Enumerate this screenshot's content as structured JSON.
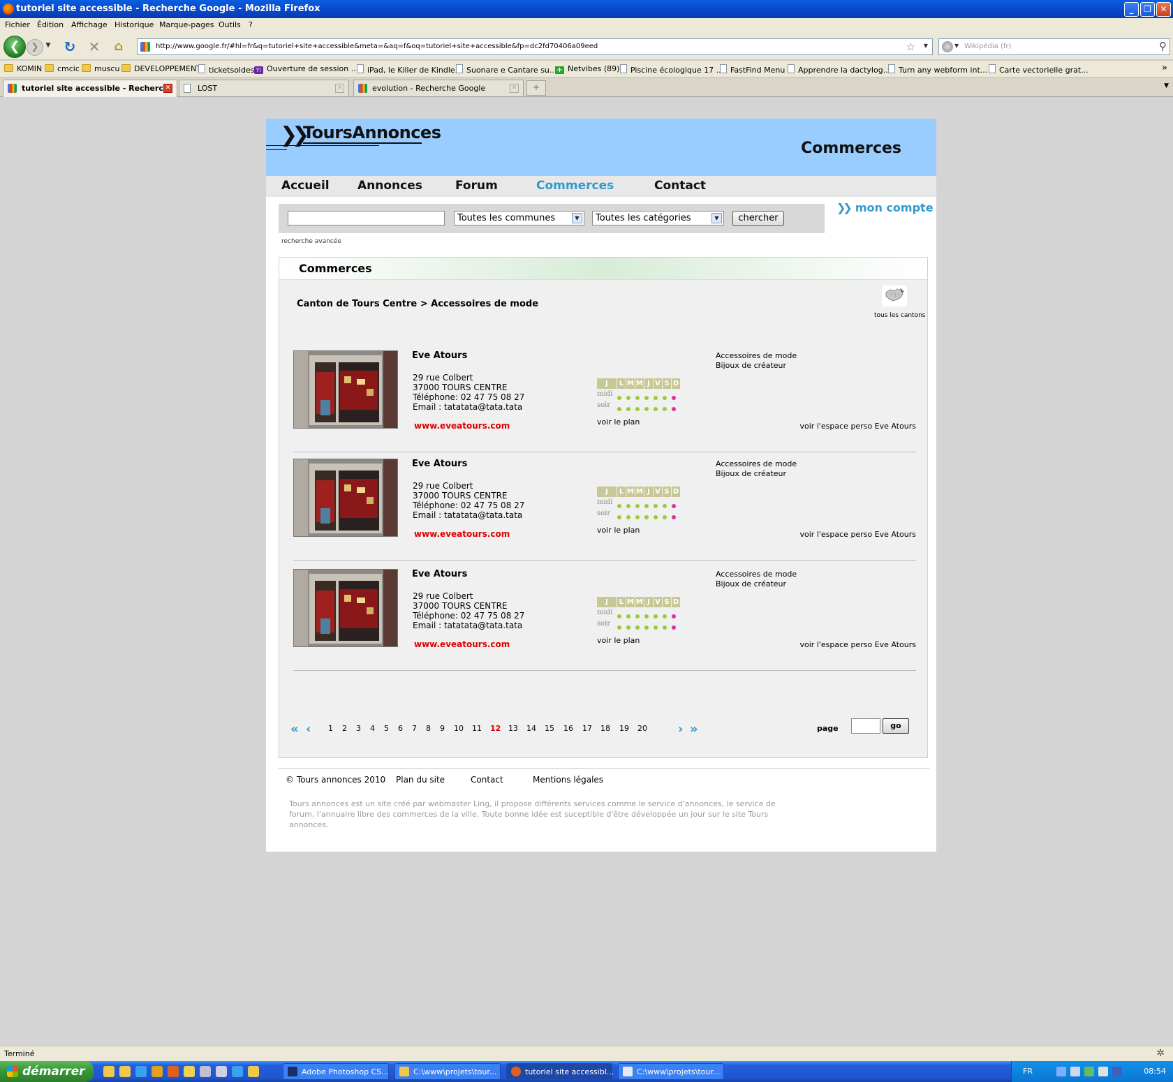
{
  "window": {
    "title": "tutoriel site accessible - Recherche Google - Mozilla Firefox"
  },
  "menu": [
    "Fichier",
    "Édition",
    "Affichage",
    "Historique",
    "Marque-pages",
    "Outils",
    "?"
  ],
  "url": "http://www.google.fr/#hl=fr&q=tutoriel+site+accessible&meta=&aq=f&oq=tutoriel+site+accessible&fp=dc2fd70406a09eed",
  "search_engine_placeholder": "Wikipédia (fr)",
  "bookmarks": [
    {
      "label": "KOMIN",
      "icon": "folder-icon"
    },
    {
      "label": "cmcic",
      "icon": "folder-icon"
    },
    {
      "label": "muscu",
      "icon": "folder-icon"
    },
    {
      "label": "DEVELOPPEMENT",
      "icon": "folder-icon"
    },
    {
      "label": "ticketsoldes",
      "icon": "page-icon"
    },
    {
      "label": "Ouverture de session ...",
      "icon": "yahoo-icon"
    },
    {
      "label": "iPad, le Killer de Kindle...",
      "icon": "page-icon"
    },
    {
      "label": "Suonare e Cantare su...",
      "icon": "page-icon"
    },
    {
      "label": "Netvibes (89)",
      "icon": "netvibes-icon"
    },
    {
      "label": "Piscine écologique 17 ...",
      "icon": "page-icon"
    },
    {
      "label": "FastFind Menu",
      "icon": "page-icon"
    },
    {
      "label": "Apprendre la dactylog...",
      "icon": "page-icon"
    },
    {
      "label": "Turn any webform int...",
      "icon": "page-icon"
    },
    {
      "label": "Carte vectorielle grat...",
      "icon": "page-icon"
    }
  ],
  "tabs": [
    {
      "label": "tutoriel site accessible - Recherc...",
      "active": true
    },
    {
      "label": "LOST",
      "active": false
    },
    {
      "label": "evolution - Recherche Google",
      "active": false
    }
  ],
  "site": {
    "logo": "ToursAnnonces",
    "header_title": "Commerces",
    "nav": [
      "Accueil",
      "Annonces",
      "Forum",
      "Commerces",
      "Contact"
    ],
    "nav_current": "Commerces",
    "search": {
      "query": "",
      "commune": "Toutes les communes",
      "categorie": "Toutes les catégories",
      "button": "chercher",
      "advanced": "recherche avancée"
    },
    "account": "mon compte",
    "section_title": "Commerces",
    "breadcrumb": "Canton de Tours Centre > Accessoires de mode",
    "all_cantons": "tous les cantons",
    "listings": [
      {
        "name": "Eve Atours",
        "street": "29 rue Colbert",
        "city": "37000 TOURS CENTRE",
        "phone": "Téléphone: 02 47 75 08 27",
        "email": "Email : tatatata@tata.tata",
        "website": "www.eveatours.com",
        "categories": [
          "Accessoires de mode",
          "Bijoux de créateur"
        ],
        "map_link": "voir le plan",
        "perso_link": "voir l'espace perso Eve Atours"
      },
      {
        "name": "Eve Atours",
        "street": "29 rue Colbert",
        "city": "37000 TOURS CENTRE",
        "phone": "Téléphone: 02 47 75 08 27",
        "email": "Email : tatatata@tata.tata",
        "website": "www.eveatours.com",
        "categories": [
          "Accessoires de mode",
          "Bijoux de créateur"
        ],
        "map_link": "voir le plan",
        "perso_link": "voir l'espace perso Eve Atours"
      },
      {
        "name": "Eve Atours",
        "street": "29 rue Colbert",
        "city": "37000 TOURS CENTRE",
        "phone": "Téléphone: 02 47 75 08 27",
        "email": "Email : tatatata@tata.tata",
        "website": "www.eveatours.com",
        "categories": [
          "Accessoires de mode",
          "Bijoux de créateur"
        ],
        "map_link": "voir le plan",
        "perso_link": "voir l'espace perso Eve Atours"
      }
    ],
    "hours": {
      "day_header": [
        "J",
        "L",
        "M",
        "M",
        "J",
        "V",
        "S",
        "D"
      ],
      "midi_label": "midi",
      "soir_label": "soir",
      "midi_open": [
        true,
        true,
        true,
        true,
        true,
        true,
        false
      ],
      "soir_open": [
        true,
        true,
        true,
        true,
        true,
        true,
        false
      ],
      "open_color": "#99cc33",
      "closed_color": "#dd3399"
    },
    "pagination": {
      "first": "«",
      "prev": "‹",
      "next": "›",
      "last": "»",
      "pages": [
        "1",
        "2",
        "3",
        "4",
        "5",
        "6",
        "7",
        "8",
        "9",
        "10",
        "11",
        "12",
        "13",
        "14",
        "15",
        "16",
        "17",
        "18",
        "19",
        "20"
      ],
      "current": "12",
      "page_label": "page",
      "go_label": "go"
    },
    "footer": {
      "copyright": "© Tours annonces 2010",
      "links": [
        "Plan du site",
        "Contact",
        "Mentions légales"
      ],
      "text": "Tours annonces est un site créé par webmaster Ling, il propose différents services comme le service d'annonces, le service de forum, l'annuaire libre des commerces de la ville. Toute bonne idée est suceptible d'être développée un jour sur le site Tours annonces."
    },
    "colors": {
      "header_bg": "#99ccff",
      "accent": "#3399cc",
      "link_red": "#dd0000"
    }
  },
  "status": "Terminé",
  "taskbar": {
    "start_label": "démarrer",
    "tasks": [
      {
        "label": "Adobe Photoshop CS...",
        "active": false
      },
      {
        "label": "C:\\www\\projets\\tour...",
        "active": false
      },
      {
        "label": "tutoriel site accessibl...",
        "active": true
      },
      {
        "label": "C:\\www\\projets\\tour...",
        "active": false
      }
    ],
    "lang": "FR",
    "clock": "08:54"
  }
}
